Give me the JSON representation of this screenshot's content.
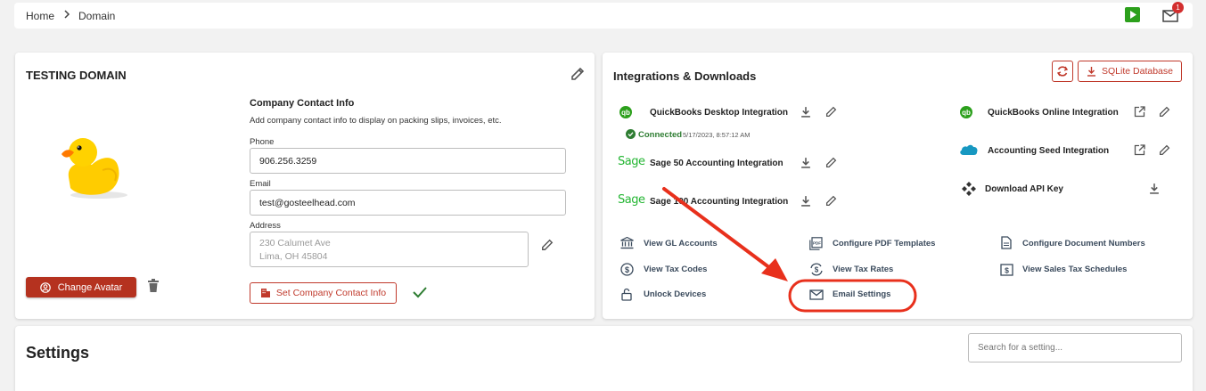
{
  "breadcrumb": {
    "home": "Home",
    "current": "Domain"
  },
  "header": {
    "notification_count": "1"
  },
  "domain_card": {
    "title": "TESTING DOMAIN",
    "change_avatar_label": "Change Avatar",
    "contact": {
      "heading": "Company Contact Info",
      "description": "Add company contact info to display on packing slips, invoices, etc.",
      "phone_label": "Phone",
      "phone_value": "906.256.3259",
      "email_label": "Email",
      "email_value": "test@gosteelhead.com",
      "address_label": "Address",
      "address_line1": "230 Calumet Ave",
      "address_line2": "Lima, OH  45804",
      "set_button_label": "Set Company Contact Info"
    }
  },
  "integrations_card": {
    "title": "Integrations & Downloads",
    "sqlite_label": "SQLite Database",
    "qb_desktop": "QuickBooks Desktop Integration",
    "connected_label": "Connected",
    "connected_time": "5/17/2023, 8:57:12 AM",
    "sage50": "Sage 50 Accounting Integration",
    "sage100": "Sage 100 Accounting Integration",
    "qb_online": "QuickBooks Online Integration",
    "accounting_seed": "Accounting Seed Integration",
    "api_key": "Download API Key",
    "sage_logo": "Sage",
    "qb_logo": "qb",
    "links": {
      "gl_accounts": "View GL Accounts",
      "tax_codes": "View Tax Codes",
      "unlock_devices": "Unlock Devices",
      "pdf_templates": "Configure PDF Templates",
      "tax_rates": "View Tax Rates",
      "email_settings": "Email Settings",
      "doc_numbers": "Configure Document Numbers",
      "sales_tax": "View Sales Tax Schedules"
    }
  },
  "settings": {
    "title": "Settings",
    "search_placeholder": "Search for a setting..."
  },
  "colors": {
    "brand_red": "#b5321f",
    "annotation_red": "#e8301c",
    "green": "#2ca01c"
  }
}
